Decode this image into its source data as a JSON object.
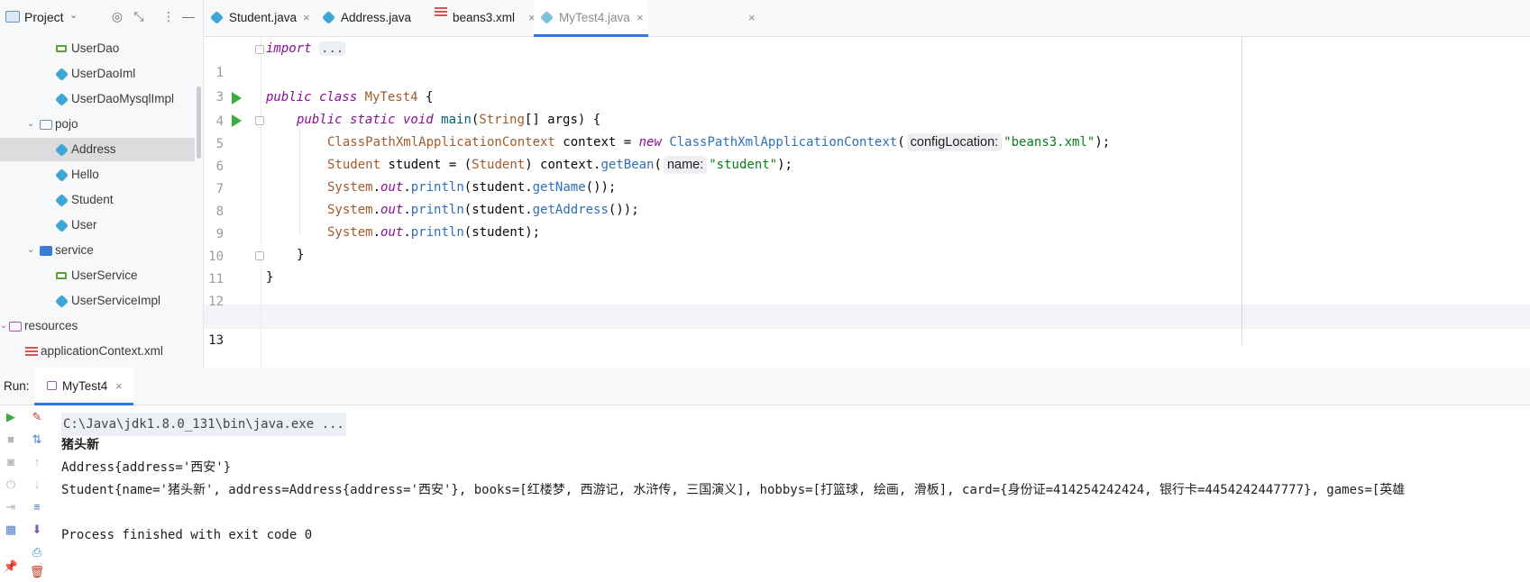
{
  "sidebar": {
    "title": "Project",
    "items": [
      {
        "label": "UserDao",
        "icon": "interface-icon",
        "indent": 1
      },
      {
        "label": "UserDaoIml",
        "icon": "class-icon",
        "indent": 1
      },
      {
        "label": "UserDaoMysqlImpl",
        "icon": "class-icon",
        "indent": 1
      },
      {
        "label": "pojo",
        "icon": "folder-icon",
        "indent": 0
      },
      {
        "label": "Address",
        "icon": "class-icon",
        "indent": 1,
        "selected": true
      },
      {
        "label": "Hello",
        "icon": "class-icon",
        "indent": 1
      },
      {
        "label": "Student",
        "icon": "class-icon",
        "indent": 1
      },
      {
        "label": "User",
        "icon": "class-icon",
        "indent": 1
      },
      {
        "label": "service",
        "icon": "package-folder-icon",
        "indent": 0
      },
      {
        "label": "UserService",
        "icon": "interface-icon",
        "indent": 1
      },
      {
        "label": "UserServiceImpl",
        "icon": "class-icon",
        "indent": 1
      },
      {
        "label": "resources",
        "icon": "resources-folder-icon",
        "indent": -1
      },
      {
        "label": "applicationContext.xml",
        "icon": "xml-file-icon",
        "indent": -1
      }
    ]
  },
  "tabs": [
    {
      "label": "Student.java",
      "icon": "class-icon"
    },
    {
      "label": "Address.java",
      "icon": "class-icon"
    },
    {
      "label": "beans3.xml",
      "icon": "xml-file-icon"
    },
    {
      "label": "MyTest4.java",
      "icon": "java-main-icon",
      "active": true
    }
  ],
  "editor": {
    "lines": {
      "l1": {
        "num": "1",
        "kw": "import",
        "fold": "..."
      },
      "l3": {
        "num": "3"
      },
      "l4": {
        "num": "4",
        "a": "public class ",
        "b": "MyTest4",
        "c": " {"
      },
      "l5": {
        "num": "5",
        "a": "public static void ",
        "b": "main",
        "c": "(",
        "d": "String",
        "e": "[] args) {"
      },
      "l6": {
        "num": "6",
        "a": "ClassPathXmlApplicationContext",
        "b": " context = ",
        "c": "new ",
        "d": "ClassPathXmlApplicationContext",
        "e": "(",
        "hint": "configLocation:",
        "f": "\"beans3.xml\"",
        "g": ");"
      },
      "l7": {
        "num": "7",
        "a": "Student",
        "b": " student = (",
        "c": "Student",
        "d": ") context.",
        "e": "getBean",
        "f": "(",
        "hint": "name:",
        "g": "\"student\"",
        "h": ");"
      },
      "l8": {
        "num": "8",
        "a": "System",
        "b": ".",
        "c": "out",
        "d": ".",
        "e": "println",
        "f": "(student.",
        "g": "getName",
        "h": "());"
      },
      "l9": {
        "num": "9",
        "a": "System",
        "b": ".",
        "c": "out",
        "d": ".",
        "e": "println",
        "f": "(student.",
        "g": "getAddress",
        "h": "());"
      },
      "l10": {
        "num": "10",
        "a": "System",
        "b": ".",
        "c": "out",
        "d": ".",
        "e": "println",
        "f": "(student);"
      },
      "l11": {
        "num": "11",
        "a": "}"
      },
      "l12": {
        "num": "12",
        "a": "}"
      },
      "l13": {
        "num": "13"
      }
    }
  },
  "run": {
    "label": "Run:",
    "tab": "MyTest4",
    "console": [
      "C:\\Java\\jdk1.8.0_131\\bin\\java.exe ...",
      "猪头新",
      "Address{address='西安'}",
      "Student{name='猪头新', address=Address{address='西安'}, books=[红楼梦, 西游记, 水浒传, 三国演义], hobbys=[打篮球, 绘画, 滑板], card={身份证=414254242424, 银行卡=4454242447777}, games=[英雄",
      "",
      "Process finished with exit code 0"
    ]
  }
}
